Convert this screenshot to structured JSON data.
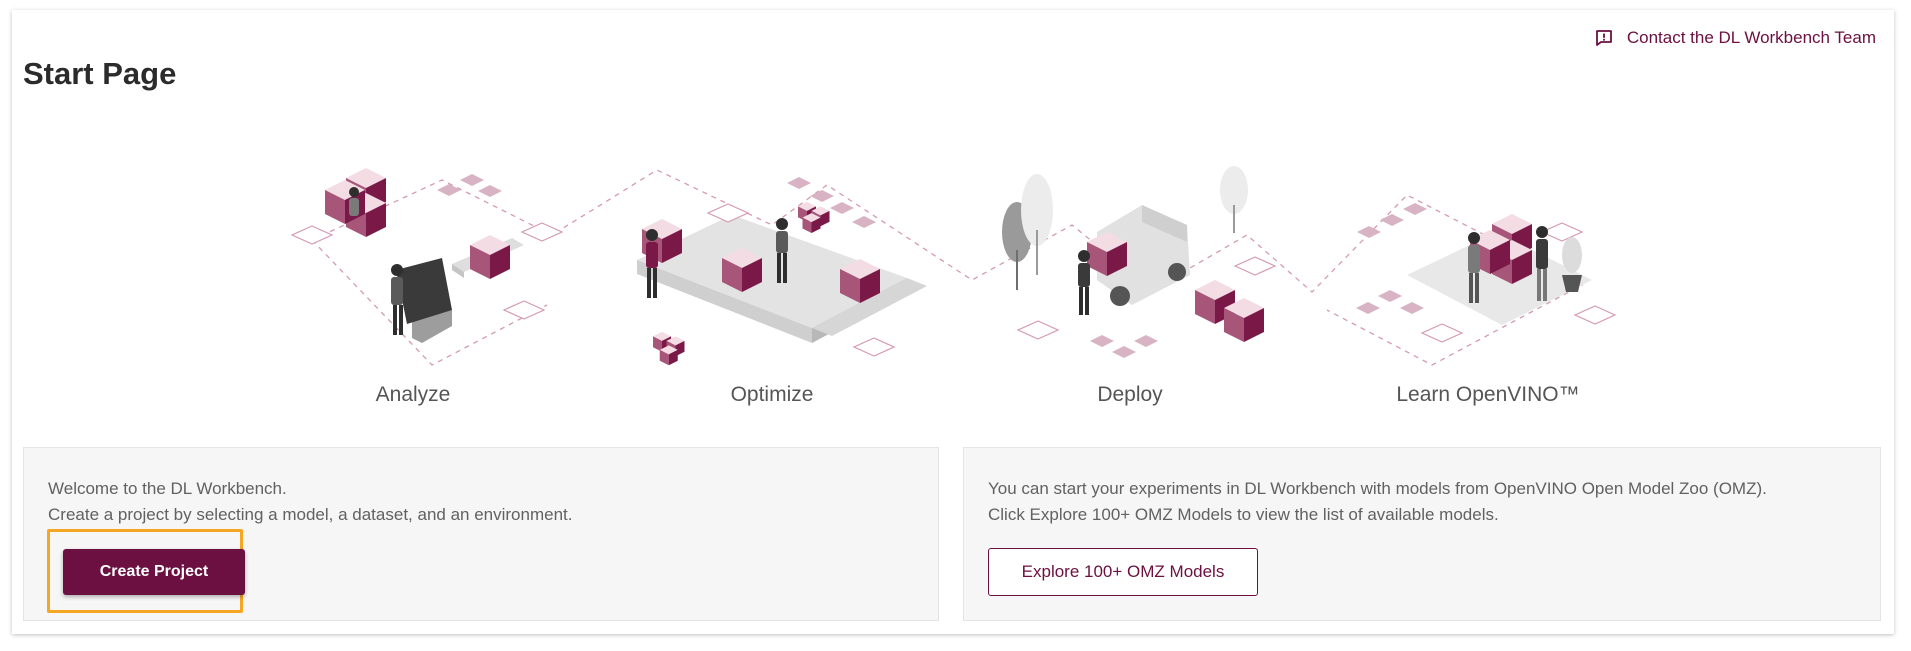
{
  "header": {
    "title": "Start Page",
    "contact_label": "Contact the DL Workbench Team",
    "contact_icon": "feedback-icon"
  },
  "features": [
    {
      "label": "Analyze"
    },
    {
      "label": "Optimize"
    },
    {
      "label": "Deploy"
    },
    {
      "label": "Learn OpenVINO™"
    }
  ],
  "create_card": {
    "line1": "Welcome to the DL Workbench.",
    "line2": "Create a project by selecting a model, a dataset, and an environment.",
    "button_label": "Create Project"
  },
  "omz_card": {
    "line1": "You can start your experiments in DL Workbench with models from OpenVINO Open Model Zoo (OMZ).",
    "line2": "Click Explore 100+ OMZ Models to view the list of available models.",
    "button_label": "Explore 100+ OMZ Models"
  },
  "colors": {
    "brand": "#6b1040",
    "highlight": "#f5a623",
    "cube_light": "#f3dce4",
    "cube_mid": "#a7567a",
    "cube_dark": "#7a1848"
  }
}
